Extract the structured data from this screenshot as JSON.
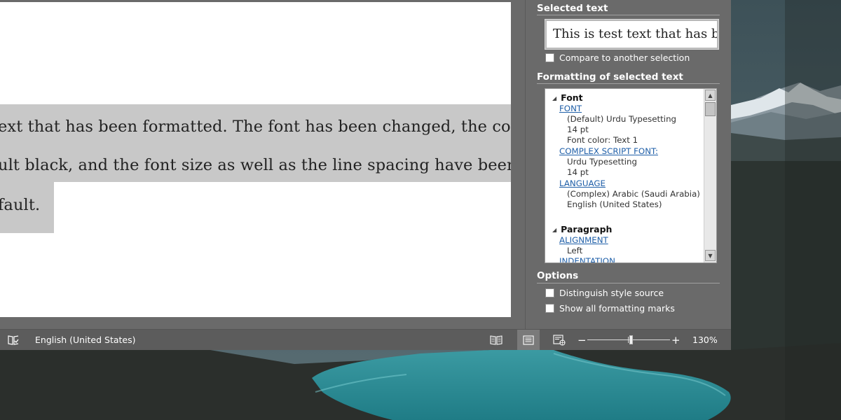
{
  "document": {
    "lines": [
      "ext that has been formatted. The font has been changed, the col",
      "ult black, and the font size as well as the line spacing have been a",
      "fault."
    ]
  },
  "reveal_formatting": {
    "selected_text_title": "Selected text",
    "selected_text_value": "This is test text that has been formatted.",
    "compare_label": "Compare to another selection",
    "formatting_title": "Formatting of selected text",
    "font_section": {
      "heading": "Font",
      "font_link": "FONT",
      "font_values": [
        "(Default) Urdu Typesetting",
        "14 pt",
        "Font color: Text 1"
      ],
      "complex_link": "COMPLEX SCRIPT FONT:",
      "complex_values": [
        "Urdu Typesetting",
        "14 pt"
      ],
      "language_link": "LANGUAGE",
      "language_values": [
        "(Complex) Arabic (Saudi Arabia)",
        "English (United States)"
      ]
    },
    "paragraph_section": {
      "heading": "Paragraph",
      "alignment_link": "ALIGNMENT",
      "alignment_value": "Left",
      "indentation_link": "INDENTATION"
    },
    "options_title": "Options",
    "distinguish_label": "Distinguish style source",
    "show_marks_label": "Show all formatting marks"
  },
  "statusbar": {
    "language": "English (United States)",
    "zoom_minus": "−",
    "zoom_plus": "+",
    "zoom_percent": "130%",
    "zoom_level": 1.3
  },
  "icons": {
    "proofing": "proofing-book-icon",
    "read_mode": "read-mode-icon",
    "print_layout": "print-layout-icon",
    "web_layout": "web-layout-icon",
    "tree_expanded": "triangle-expanded-icon",
    "scroll_up": "scroll-up-arrow-icon",
    "scroll_down": "scroll-down-arrow-icon"
  },
  "colors": {
    "link": "#1f5fa8",
    "highlight": "#c8c8c8",
    "chrome": "#6a6a6a",
    "statusbar": "#5c5c5c"
  }
}
